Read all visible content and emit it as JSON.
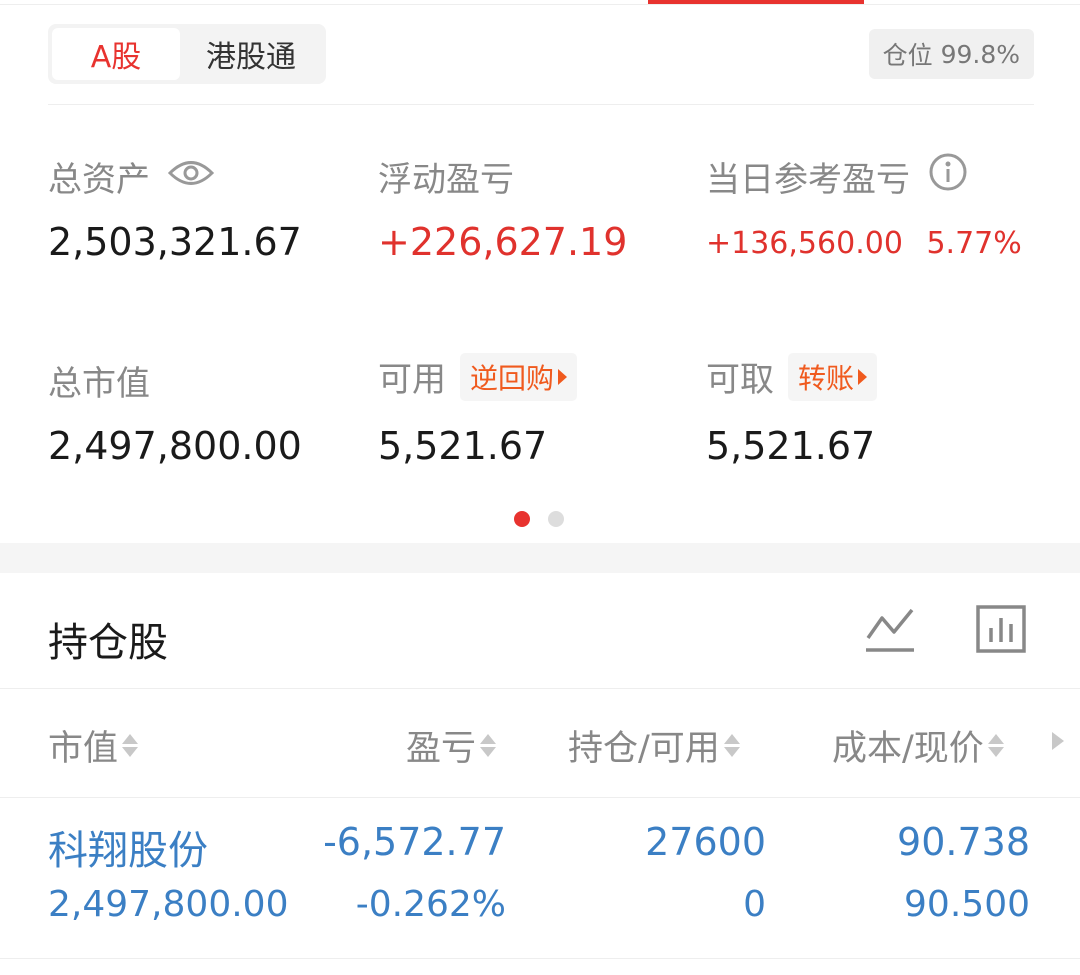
{
  "colors": {
    "accent": "#e8332f",
    "gain": "#e0322d",
    "link": "#3b7fc4",
    "tag": "#f05a1e"
  },
  "tabs": {
    "a_share": "A股",
    "hk_connect": "港股通"
  },
  "position": {
    "label": "仓位",
    "value": "99.8%"
  },
  "summary": {
    "total_assets": {
      "label": "总资产",
      "value": "2,503,321.67",
      "icon": "eye-icon"
    },
    "floating_pl": {
      "label": "浮动盈亏",
      "value": "+226,627.19"
    },
    "daily_pl": {
      "label": "当日参考盈亏",
      "value": "+136,560.00",
      "percent": "5.77%",
      "icon": "info-icon"
    },
    "market_value": {
      "label": "总市值",
      "value": "2,497,800.00"
    },
    "available": {
      "label": "可用",
      "tag": "逆回购",
      "value": "5,521.67"
    },
    "withdrawable": {
      "label": "可取",
      "tag": "转账",
      "value": "5,521.67"
    }
  },
  "pager": {
    "count": 2,
    "active": 0
  },
  "holdings": {
    "title": "持仓股",
    "columns": [
      "市值",
      "盈亏",
      "持仓/可用",
      "成本/现价"
    ],
    "rows": [
      {
        "name": "科翔股份",
        "market_value": "2,497,800.00",
        "pl": "-6,572.77",
        "pl_percent": "-0.262%",
        "position": "27600",
        "available": "0",
        "cost": "90.738",
        "price": "90.500"
      }
    ]
  }
}
